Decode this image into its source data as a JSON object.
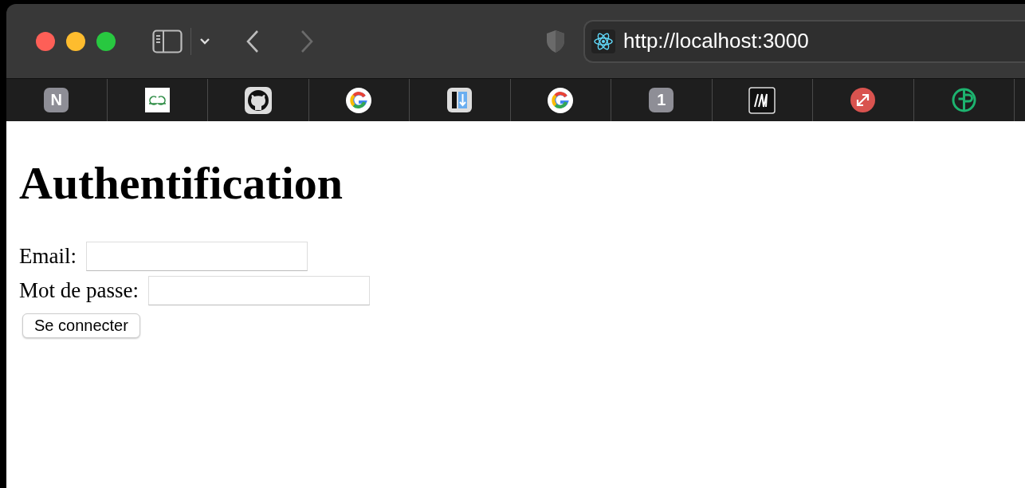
{
  "browser": {
    "url": "http://localhost:3000",
    "back_disabled": false,
    "forward_disabled": true
  },
  "bookmarks": [
    {
      "kind": "letter",
      "label": "N"
    },
    {
      "kind": "geeks"
    },
    {
      "kind": "github"
    },
    {
      "kind": "google"
    },
    {
      "kind": "ladder"
    },
    {
      "kind": "google"
    },
    {
      "kind": "letter",
      "label": "1"
    },
    {
      "kind": "m"
    },
    {
      "kind": "share"
    },
    {
      "kind": "leaf"
    }
  ],
  "page": {
    "heading": "Authentification",
    "fields": [
      {
        "label": "Email:"
      },
      {
        "label": "Mot de passe:"
      }
    ],
    "submit": "Se connecter"
  }
}
